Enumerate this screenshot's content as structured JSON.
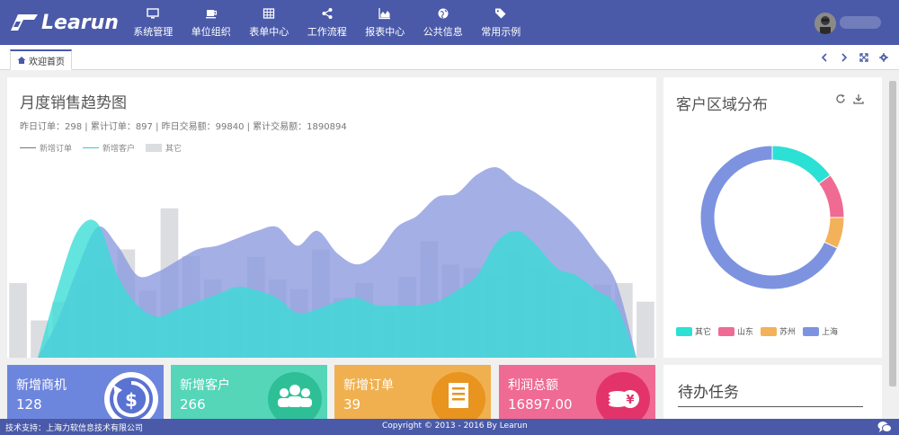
{
  "header": {
    "logo_text": "Learun",
    "nav": [
      {
        "label": "系统管理",
        "icon": "monitor-icon"
      },
      {
        "label": "单位组织",
        "icon": "coffee-icon"
      },
      {
        "label": "表单中心",
        "icon": "table-icon"
      },
      {
        "label": "工作流程",
        "icon": "share-icon"
      },
      {
        "label": "报表中心",
        "icon": "area-chart-icon"
      },
      {
        "label": "公共信息",
        "icon": "globe-icon"
      },
      {
        "label": "常用示例",
        "icon": "tags-icon"
      }
    ]
  },
  "tabs": [
    {
      "label": "欢迎首页",
      "icon": "home-icon"
    }
  ],
  "sales": {
    "title": "月度销售趋势图",
    "subtitle": "昨日订单：298 | 累计订单：897 | 昨日交易额：99840 | 累计交易额：1890894"
  },
  "region": {
    "title": "客户区域分布"
  },
  "cards": [
    {
      "label": "新增商机",
      "value": "128",
      "color": "#6d86dd",
      "icon": "dollar-cycle-icon"
    },
    {
      "label": "新增客户",
      "value": "266",
      "color": "#55d6b8",
      "icon": "users-icon"
    },
    {
      "label": "新增订单",
      "value": "39",
      "color": "#f0b050",
      "icon": "document-icon"
    },
    {
      "label": "利润总额",
      "value": "16897.00",
      "color": "#ef6b93",
      "icon": "coins-icon"
    }
  ],
  "todo": {
    "title": "待办任务"
  },
  "footer": {
    "support": "技术支持：上海力软信息技术有限公司",
    "copyright": "Copyright © 2013 - 2016 By Learun"
  },
  "colors": {
    "primary": "#4a5aa8",
    "teal": "#38dcd6",
    "lavender": "#8b98df",
    "bar": "#dcdde1"
  },
  "chart_data": [
    {
      "type": "area",
      "title": "月度销售趋势图",
      "legend_placement": "top-left",
      "grid": false,
      "series": [
        {
          "name": "新增订单",
          "type": "area",
          "values": [
            0,
            50,
            120,
            175,
            150,
            110,
            115,
            130,
            145,
            150,
            160,
            170,
            175,
            150,
            170,
            140,
            125,
            140,
            175,
            190,
            215,
            220,
            245,
            255,
            235,
            220,
            200,
            175,
            140,
            100,
            0
          ]
        },
        {
          "name": "新增客户",
          "type": "area",
          "values": [
            0,
            95,
            170,
            180,
            110,
            70,
            55,
            65,
            75,
            85,
            95,
            90,
            80,
            60,
            65,
            75,
            80,
            70,
            70,
            70,
            75,
            90,
            110,
            155,
            170,
            150,
            120,
            110,
            90,
            70,
            0
          ]
        },
        {
          "name": "其它",
          "type": "bar",
          "values": [
            100,
            50,
            75,
            100,
            120,
            145,
            90,
            200,
            136,
            105,
            88,
            135,
            105,
            92,
            145,
            80,
            100,
            62,
            108,
            156,
            125,
            120,
            112,
            140,
            118,
            100,
            85,
            98,
            100,
            75
          ]
        }
      ]
    },
    {
      "type": "pie",
      "title": "客户区域分布",
      "legend_placement": "bottom",
      "slices": [
        {
          "name": "其它",
          "value": 15,
          "color": "#2be0d4"
        },
        {
          "name": "山东",
          "value": 10,
          "color": "#ef6b93"
        },
        {
          "name": "苏州",
          "value": 7,
          "color": "#f3b159"
        },
        {
          "name": "上海",
          "value": 68,
          "color": "#7d93e0"
        }
      ]
    }
  ]
}
